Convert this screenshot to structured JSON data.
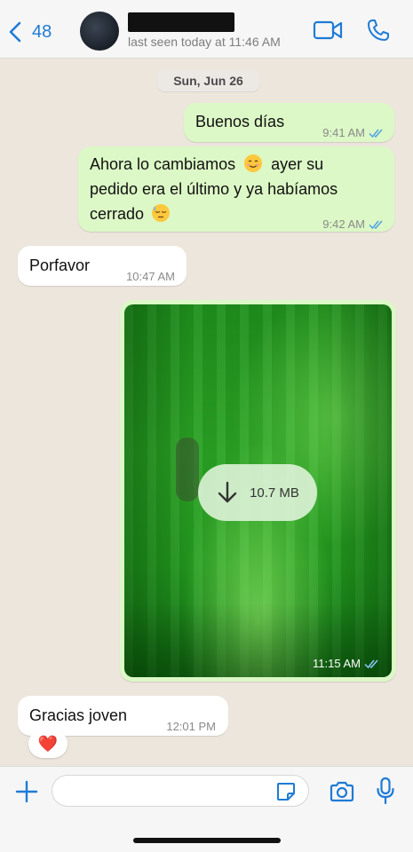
{
  "header": {
    "back_count": "48",
    "last_seen": "last seen today at 11:46 AM",
    "icons": [
      "chevron-left-icon",
      "video-call-icon",
      "phone-icon"
    ]
  },
  "chat": {
    "date_chip": "Sun, Jun 26",
    "messages": [
      {
        "direction": "outgoing",
        "text": "Buenos días",
        "time": "9:41 AM",
        "read": true
      },
      {
        "direction": "outgoing",
        "lines": [
          "Ahora lo cambiamos",
          "ayer su",
          "pedido era el último y ya habíamos",
          "cerrado"
        ],
        "emojis": [
          "smiling-face-emoji",
          "sleepy-face-emoji"
        ],
        "time": "9:42 AM",
        "read": true
      },
      {
        "direction": "incoming",
        "text": "Porfavor",
        "time": "10:47 AM"
      },
      {
        "direction": "outgoing",
        "type": "image",
        "download_size": "10.7 MB",
        "time": "11:15 AM",
        "read": true
      },
      {
        "direction": "incoming",
        "text": "Gracias joven",
        "time": "12:01 PM",
        "reaction": "❤️"
      }
    ]
  },
  "composer": {
    "placeholder": "",
    "icons": [
      "plus-icon",
      "sticker-icon",
      "camera-icon",
      "microphone-icon"
    ]
  },
  "colors": {
    "accent": "#1e7bd6",
    "outgoing_bubble": "#dcf8c6",
    "incoming_bubble": "#ffffff",
    "chat_background": "#ece6dd",
    "read_ticks": "#4fa3e0"
  }
}
